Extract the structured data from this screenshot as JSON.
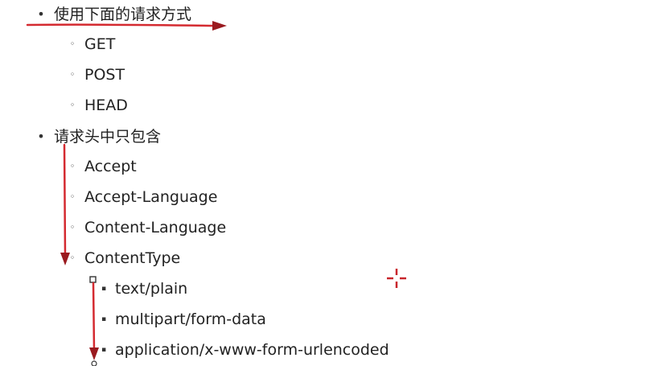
{
  "outline": {
    "level1": [
      {
        "bullet": "•",
        "label": "使用下面的请求方式",
        "children": [
          {
            "bullet": "◦",
            "label": "GET"
          },
          {
            "bullet": "◦",
            "label": "POST"
          },
          {
            "bullet": "◦",
            "label": "HEAD"
          }
        ]
      },
      {
        "bullet": "•",
        "label": "请求头中只包含",
        "children": [
          {
            "bullet": "◦",
            "label": "Accept"
          },
          {
            "bullet": "◦",
            "label": "Accept-Language"
          },
          {
            "bullet": "◦",
            "label": "Content-Language"
          },
          {
            "bullet": "◦",
            "label": "ContentType",
            "children": [
              {
                "bullet": "▪",
                "label": "text/plain"
              },
              {
                "bullet": "▪",
                "label": "multipart/form-data"
              },
              {
                "bullet": "▪",
                "label": "application/x-www-form-urlencoded"
              }
            ]
          }
        ]
      }
    ]
  },
  "annotation_color": "#d42a30",
  "annotation_dark": "#9a1a1f"
}
